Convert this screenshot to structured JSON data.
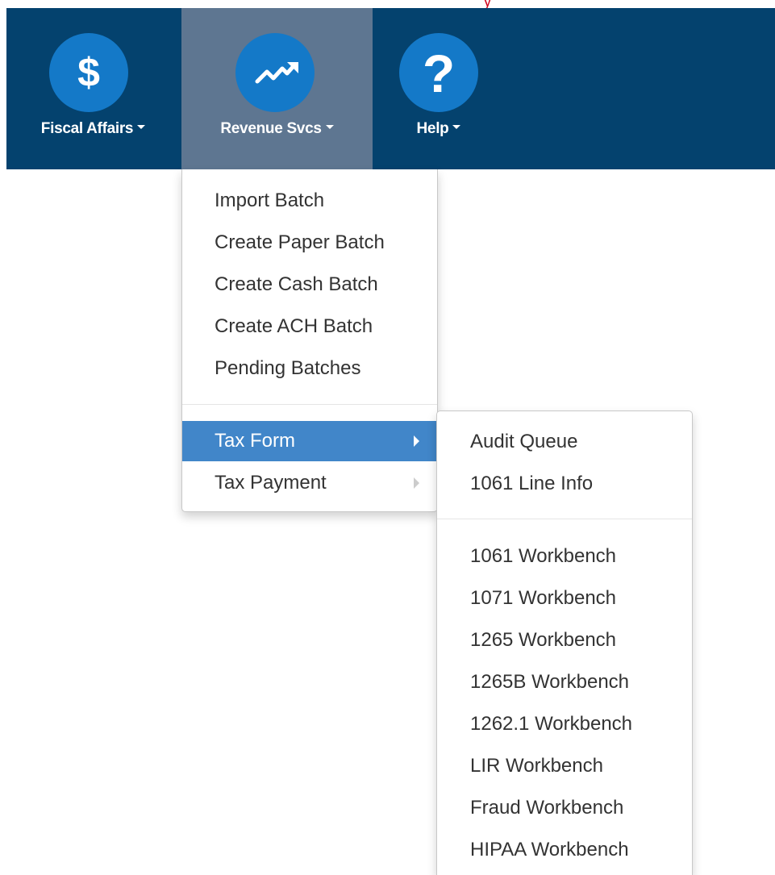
{
  "navbar": {
    "items": [
      {
        "label": "Fiscal Affairs",
        "icon": "dollar-sign-icon"
      },
      {
        "label": "Revenue Svcs",
        "icon": "trending-up-icon"
      },
      {
        "label": "Help",
        "icon": "question-mark-icon"
      }
    ]
  },
  "menus": {
    "revenue": {
      "items": [
        "Import Batch",
        "Create Paper Batch",
        "Create Cash Batch",
        "Create ACH Batch",
        "Pending Batches"
      ],
      "submenus": [
        {
          "label": "Tax Form"
        },
        {
          "label": "Tax Payment"
        }
      ]
    },
    "tax_form": {
      "top_items": [
        "Audit Queue",
        "1061 Line Info"
      ],
      "workbench_items": [
        "1061 Workbench",
        "1071 Workbench",
        "1265 Workbench",
        "1265B Workbench",
        "1262.1 Workbench",
        "LIR Workbench",
        "Fraud Workbench",
        "HIPAA Workbench"
      ]
    }
  },
  "colors": {
    "navbar_bg": "#04426e",
    "active_nav_bg": "#5e7691",
    "icon_circle": "#1479c8",
    "highlight": "#4186c9"
  }
}
